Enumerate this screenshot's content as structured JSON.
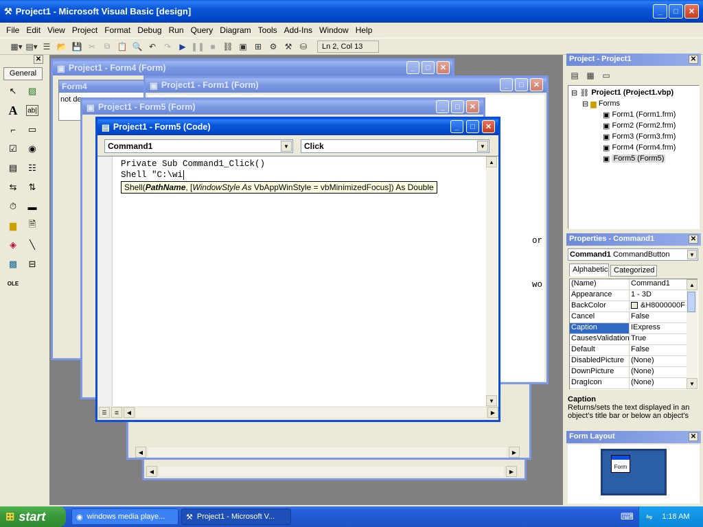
{
  "app": {
    "title": "Project1 - Microsoft Visual Basic [design]",
    "menu": [
      "File",
      "Edit",
      "View",
      "Project",
      "Format",
      "Debug",
      "Run",
      "Query",
      "Diagram",
      "Tools",
      "Add-Ins",
      "Window",
      "Help"
    ],
    "position": "Ln 2, Col 13"
  },
  "toolbox": {
    "tab": "General",
    "items": [
      "pointer-icon",
      "picturebox-icon",
      "label-icon",
      "textbox-icon",
      "frame-icon",
      "commandbutton-icon",
      "checkbox-icon",
      "optionbutton-icon",
      "combobox-icon",
      "listbox-icon",
      "hscrollbar-icon",
      "vscrollbar-icon",
      "timer-icon",
      "drivelistbox-icon",
      "dirlistbox-icon",
      "filelistbox-icon",
      "shape-icon",
      "line-icon",
      "image-icon",
      "data-icon",
      "ole-icon"
    ]
  },
  "windows": {
    "form4": {
      "title": "Project1 - Form4 (Form)",
      "caption": "Form4",
      "text": "not de"
    },
    "form1": {
      "title": "Project1 - Form1 (Form)",
      "text_or": "or",
      "text_wo": "wo"
    },
    "form5": {
      "title": "Project1 - Form5 (Form)"
    },
    "code": {
      "title": "Project1 - Form5 (Code)",
      "object": "Command1",
      "procedure": "Click",
      "lines": [
        "Private Sub Command1_Click()",
        "Shell \"C:\\wi"
      ],
      "tooltip_fn": "Shell(",
      "tooltip_param": "PathName",
      "tooltip_sep": ", [",
      "tooltip_opt": "WindowStyle As",
      "tooltip_rest": " VbAppWinStyle = vbMinimizedFocus]) As Double"
    }
  },
  "project": {
    "title": "Project - Project1",
    "root": "Project1 (Project1.vbp)",
    "folder": "Forms",
    "items": [
      "Form1 (Form1.frm)",
      "Form2 (Form2.frm)",
      "Form3 (Form3.frm)",
      "Form4 (Form4.frm)",
      "Form5 (Form5)"
    ]
  },
  "properties": {
    "title": "Properties - Command1",
    "object": "Command1",
    "object_type": "CommandButton",
    "tabs": [
      "Alphabetic",
      "Categorized"
    ],
    "rows": [
      {
        "name": "(Name)",
        "value": "Command1"
      },
      {
        "name": "Appearance",
        "value": "1 - 3D"
      },
      {
        "name": "BackColor",
        "value": "&H8000000F"
      },
      {
        "name": "Cancel",
        "value": "False"
      },
      {
        "name": "Caption",
        "value": "IExpress"
      },
      {
        "name": "CausesValidation",
        "value": "True"
      },
      {
        "name": "Default",
        "value": "False"
      },
      {
        "name": "DisabledPicture",
        "value": "(None)"
      },
      {
        "name": "DownPicture",
        "value": "(None)"
      },
      {
        "name": "DragIcon",
        "value": "(None)"
      }
    ],
    "desc_title": "Caption",
    "desc_text": "Returns/sets the text displayed in an object's title bar or below an object's"
  },
  "form_layout": {
    "title": "Form Layout",
    "form_label": "Form"
  },
  "taskbar": {
    "start": "start",
    "items": [
      "windows media playe...",
      "Project1 - Microsoft V..."
    ],
    "clock": "1:18 AM"
  },
  "colors": {
    "mdi_bg": "#808080",
    "xp_blue": "#0a4ee0",
    "taskbar": "#245edb",
    "start_green": "#3c9a3c"
  }
}
